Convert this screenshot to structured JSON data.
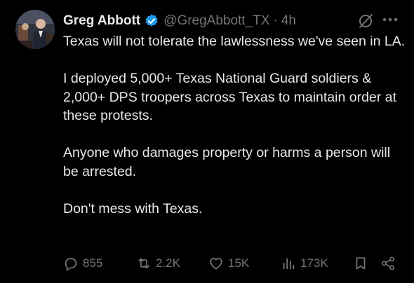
{
  "author": {
    "name": "Greg Abbott",
    "handle": "@GregAbbott_TX",
    "separator": "·",
    "time": "4h"
  },
  "tweet": {
    "paragraphs": [
      "Texas will not tolerate the lawlessness we've seen in LA.",
      "I deployed 5,000+ Texas National Guard soldiers & 2,000+ DPS troopers across Texas to maintain order at these protests.",
      "Anyone who damages property or harms a person will be arrested.",
      "Don't mess with Texas."
    ]
  },
  "stats": {
    "replies": "855",
    "reposts": "2.2K",
    "likes": "15K",
    "views": "173K"
  },
  "icons": {
    "verified": "verified-badge-icon",
    "grok": "grok-icon",
    "more": "more-icon",
    "reply": "reply-icon",
    "repost": "repost-icon",
    "like": "like-icon",
    "views": "views-icon",
    "bookmark": "bookmark-icon",
    "share": "share-icon"
  },
  "colors": {
    "background": "#000000",
    "text": "#e7e9ea",
    "muted": "#71767b",
    "verified": "#1d9bf0"
  }
}
